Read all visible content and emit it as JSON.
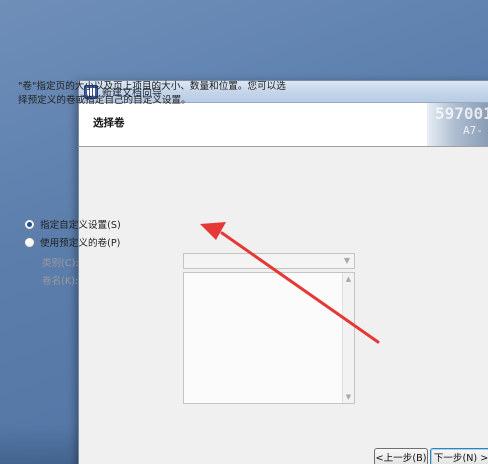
{
  "window": {
    "title": "新建文档向导",
    "header_title": "选择卷",
    "banner_text_1": "597001",
    "banner_text_2": "A7-"
  },
  "description": "\"卷\"指定页的大小以及页上项目的大小、数量和位置。您可以选择预定义的卷或指定自己的自定义设置。",
  "options": {
    "custom": {
      "label": "指定自定义设置(S)",
      "checked": true
    },
    "predefined": {
      "label": "使用预定义的卷(P)",
      "checked": false
    }
  },
  "fields": {
    "category_label": "类别(C):",
    "category_value": "",
    "volume_name_label": "卷名(K):"
  },
  "buttons": {
    "back": "<上一步(B)",
    "next": "下一步(N) >"
  },
  "colors": {
    "arrow": "#e53935",
    "desktop": "#5b7eac"
  }
}
